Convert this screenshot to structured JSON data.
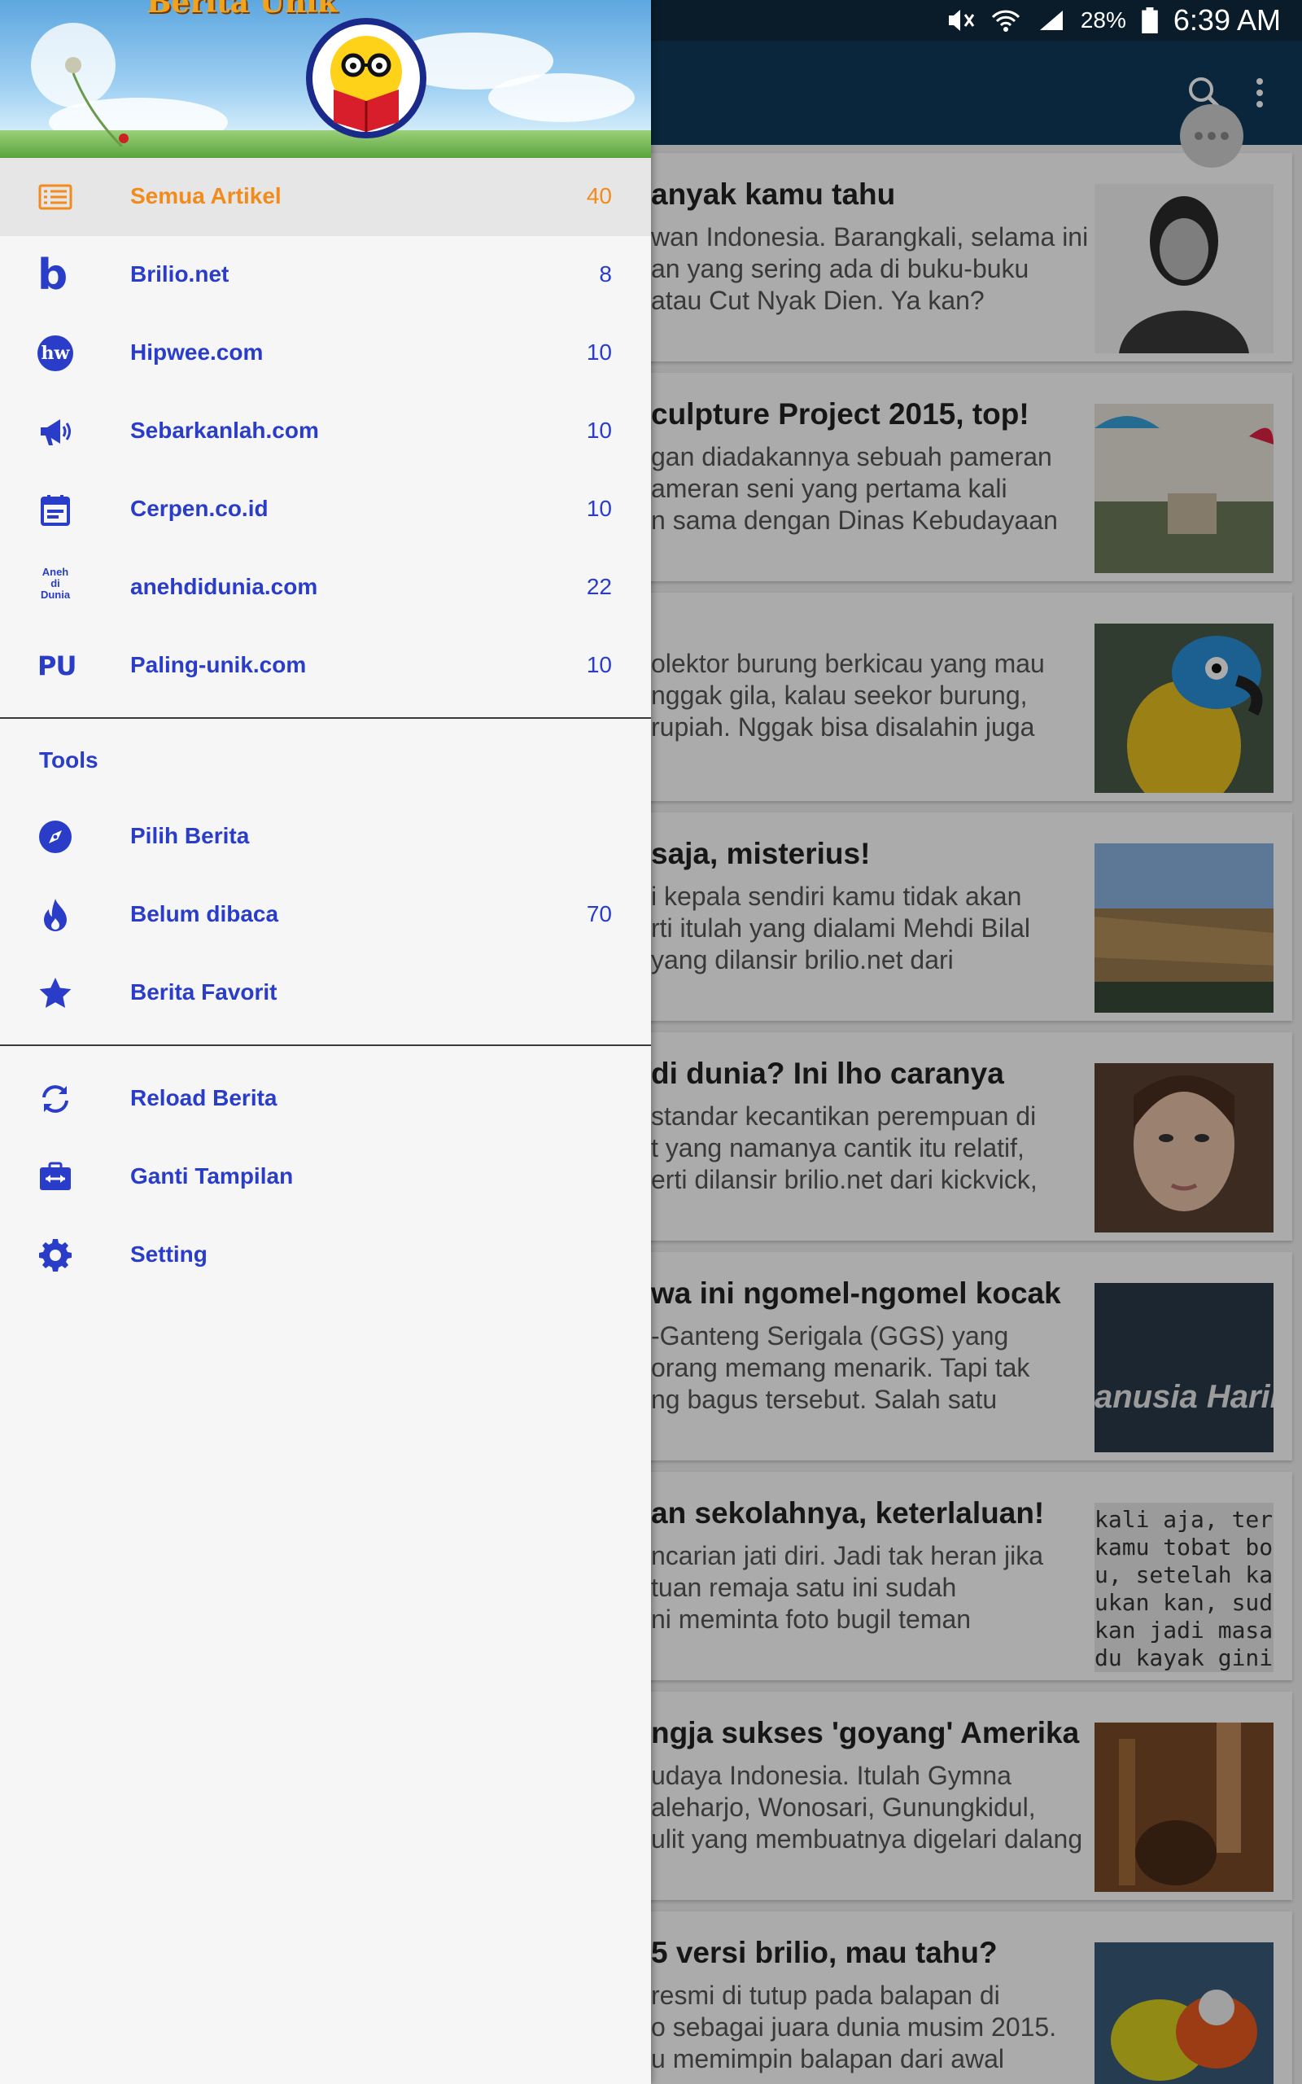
{
  "status_bar": {
    "battery": "28%",
    "time": "6:39 AM"
  },
  "drawer": {
    "brand": "Berita Unik",
    "sources": [
      {
        "label": "Semua Artikel",
        "count": "40",
        "icon": "list-icon"
      },
      {
        "label": "Brilio.net",
        "count": "8",
        "icon": "brilio-logo-icon"
      },
      {
        "label": "Hipwee.com",
        "count": "10",
        "icon": "hipwee-logo-icon"
      },
      {
        "label": "Sebarkanlah.com",
        "count": "10",
        "icon": "megaphone-icon"
      },
      {
        "label": "Cerpen.co.id",
        "count": "10",
        "icon": "calendar-icon"
      },
      {
        "label": "anehdidunia.com",
        "count": "22",
        "icon": "aneh-di-dunia-logo-icon"
      },
      {
        "label": "Paling-unik.com",
        "count": "10",
        "icon": "pu-logo-icon"
      }
    ],
    "tools_title": "Tools",
    "tools": [
      {
        "label": "Pilih Berita",
        "count": "",
        "icon": "compass-icon"
      },
      {
        "label": "Belum dibaca",
        "count": "70",
        "icon": "flame-icon"
      },
      {
        "label": "Berita Favorit",
        "count": "",
        "icon": "star-icon"
      }
    ],
    "actions": [
      {
        "label": "Reload Berita",
        "icon": "reload-icon"
      },
      {
        "label": "Ganti Tampilan",
        "icon": "switch-view-icon"
      },
      {
        "label": "Setting",
        "icon": "gear-icon"
      }
    ],
    "logo_labels": {
      "brilio": "b",
      "hipwee": "hw",
      "aneh": [
        "Aneh",
        "di",
        "Dunia"
      ],
      "pu": "PU"
    }
  },
  "feed": {
    "articles": [
      {
        "title": "anyak kamu tahu",
        "lines": [
          "wan Indonesia. Barangkali, selama ini",
          "an yang sering ada di buku-buku",
          "atau Cut Nyak Dien. Ya kan?"
        ]
      },
      {
        "title": "culpture Project 2015, top!",
        "lines": [
          "gan diadakannya sebuah pameran",
          "ameran seni yang pertama kali",
          "n sama dengan Dinas Kebudayaan"
        ]
      },
      {
        "title": "",
        "lines": [
          "olektor burung berkicau yang mau",
          "nggak gila, kalau seekor burung,",
          "rupiah. Nggak bisa disalahin juga"
        ]
      },
      {
        "title": "saja, misterius!",
        "lines": [
          "i kepala sendiri kamu tidak akan",
          "rti itulah yang dialami Mehdi Bilal",
          "yang dilansir brilio.net dari"
        ]
      },
      {
        "title": "di dunia? Ini lho caranya",
        "lines": [
          "standar kecantikan perempuan di",
          "t yang namanya cantik itu relatif,",
          "erti dilansir brilio.net dari kickvick,"
        ]
      },
      {
        "title": "wa ini ngomel-ngomel kocak",
        "lines": [
          "-Ganteng Serigala (GGS) yang",
          "orang memang menarik. Tapi tak",
          "ng bagus tersebut. Salah satu"
        ]
      },
      {
        "title": "an sekolahnya, keterlaluan!",
        "lines": [
          "ncarian jati diri. Jadi tak heran jika",
          "tuan remaja satu ini sudah",
          "ni meminta foto bugil teman"
        ]
      },
      {
        "title": "ngja sukses 'goyang' Amerika",
        "lines": [
          "udaya Indonesia. Itulah Gymna",
          "aleharjo, Wonosari, Gunungkidul,",
          "ulit yang membuatnya digelari dalang"
        ]
      },
      {
        "title": "5 versi brilio, mau tahu?",
        "lines": [
          "resmi di tutup pada balapan di",
          "o sebagai juara dunia musim 2015.",
          "u memimpin balapan dari awal"
        ]
      }
    ],
    "thumb_texts": {
      "ggs": "anusia Harim",
      "handwriting": [
        "kali aja, terus s",
        "kamu tobat bo",
        "u, setelah kam",
        "ukan kan, sud",
        "kan jadi masa",
        "du kayak gini k"
      ]
    }
  }
}
